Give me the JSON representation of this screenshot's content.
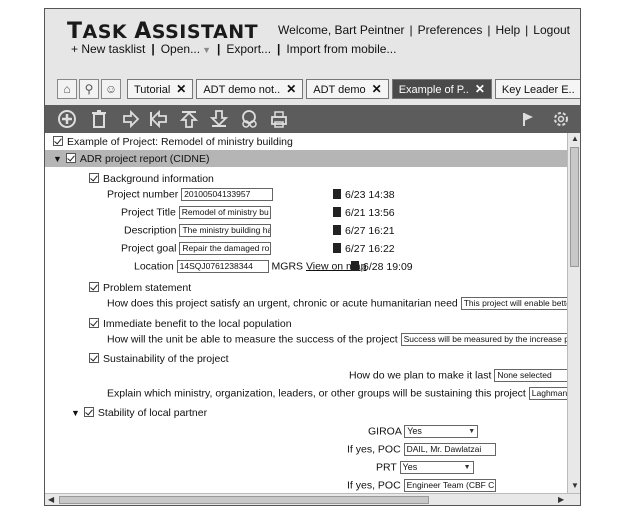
{
  "app": {
    "title": "Task Assistant",
    "welcome": "Welcome, Bart Peintner",
    "links": [
      "Preferences",
      "Help",
      "Logout"
    ]
  },
  "menu": {
    "new_tasklist": "+ New tasklist",
    "open": "Open...",
    "export": "Export...",
    "import": "Import from mobile..."
  },
  "tabs": [
    {
      "label": "Tutorial",
      "active": false
    },
    {
      "label": "ADT demo not..",
      "active": false
    },
    {
      "label": "ADT demo",
      "active": false
    },
    {
      "label": "Example of P..",
      "active": true
    },
    {
      "label": "Key Leader E..",
      "active": false
    }
  ],
  "tab_icons": [
    "home-icon",
    "search-icon",
    "people-icon"
  ],
  "toolbar_icons": [
    "add-icon",
    "delete-icon",
    "indent-icon",
    "outdent-icon",
    "move-up-icon",
    "move-down-icon",
    "users-icon",
    "print-icon",
    "flag-icon",
    "settings-icon"
  ],
  "content": {
    "root": "Example of Project: Remodel of ministry building",
    "section": "ADR project report (CIDNE)",
    "background": {
      "label": "Background information",
      "fields": [
        {
          "label": "Project number",
          "value": "20100504133957",
          "timestamp": "6/23 14:38"
        },
        {
          "label": "Project Title",
          "value": "Remodel of ministry bu",
          "timestamp": "6/21 13:56"
        },
        {
          "label": "Description",
          "value": "The ministry building ha",
          "timestamp": "6/27 16:21"
        },
        {
          "label": "Project goal",
          "value": "Repair the damaged ro",
          "timestamp": "6/27 16:22"
        },
        {
          "label": "Location",
          "value": "14SQJ0761238344",
          "suffix": "MGRS",
          "link": "View on map",
          "timestamp": "6/28 19:09"
        }
      ]
    },
    "problem": {
      "label": "Problem statement",
      "question": "How does this project satisfy an urgent, chronic or acute humanitarian need",
      "answer": "This project will enable better and safer"
    },
    "benefit": {
      "label": "Immediate benefit to the local population",
      "question": "How will the unit be able to measure the success of the project",
      "answer": "Success will be measured by the increase perform"
    },
    "sustainability": {
      "label": "Sustainability of the project",
      "question1": "How do we plan to make it last",
      "answer1": "None selected",
      "question2": "Explain which ministry, organization, leaders, or other groups will be sustaining this project",
      "answer2": "Laghman Director of Ag"
    },
    "stability": {
      "label": "Stability of local partner",
      "giroa_label": "GIROA",
      "giroa_value": "Yes",
      "poc1_label": "If yes, POC",
      "poc1_value": "DAIL, Mr. Dawlatzai",
      "prt_label": "PRT",
      "prt_value": "Yes",
      "poc2_label": "If yes, POC",
      "poc2_value": "Engineer Team (CBF C"
    }
  }
}
